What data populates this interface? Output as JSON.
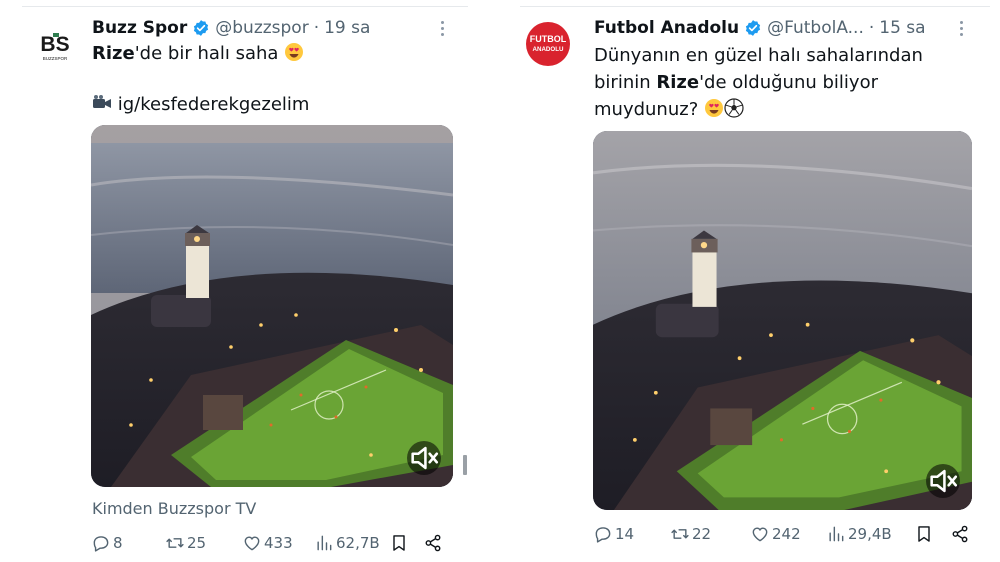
{
  "tweets": [
    {
      "author_name": "Buzz Spor",
      "handle": "@buzzspor",
      "separator": "·",
      "time": "19 sa",
      "text_bold": "Rize",
      "text_rest": "'de bir halı saha",
      "text_line2": "ig/kesfederekgezelim",
      "avatar_text": "BS",
      "avatar_subtext": "BUZZSPOR",
      "source": "Kimden Buzzspor TV",
      "stats": {
        "replies": "8",
        "reposts": "25",
        "likes": "433",
        "views": "62,7B"
      }
    },
    {
      "author_name": "Futbol Anadolu",
      "handle": "@FutbolA...",
      "separator": "·",
      "time": "15 sa",
      "text_line1": "Dünyanın en güzel halı sahalarından",
      "text_pre": "birinin ",
      "text_bold": "Rize",
      "text_post": "'de olduğunu biliyor",
      "text_line3": "muydunuz?",
      "avatar_line1": "FUTBOL",
      "avatar_line2": "ANADOLU",
      "stats": {
        "replies": "14",
        "reposts": "22",
        "likes": "242",
        "views": "29,4B"
      }
    }
  ],
  "colors": {
    "text": "#0f1419",
    "secondary": "#536471",
    "verified": "#1d9bf0",
    "futbol_red": "#d9232e",
    "bs_green": "#2e7d4f"
  },
  "icons": [
    "verified-badge-icon",
    "more-icon",
    "smiling-face-heart-eyes-emoji",
    "video-camera-emoji",
    "soccer-ball-emoji",
    "mute-icon",
    "reply-icon",
    "repost-icon",
    "like-icon",
    "views-icon",
    "bookmark-icon",
    "share-icon"
  ]
}
